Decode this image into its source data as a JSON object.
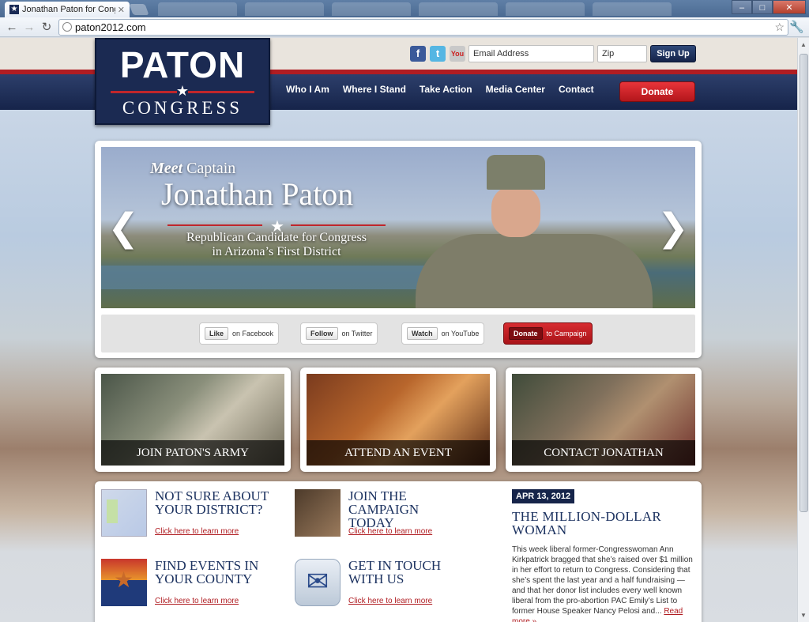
{
  "browser": {
    "tab_title": "Jonathan Paton for Congress",
    "url": "paton2012.com"
  },
  "header": {
    "logo_top": "PATON",
    "logo_bottom": "CONGRESS",
    "email_placeholder": "Email Address",
    "zip_placeholder": "Zip",
    "signup_label": "Sign Up",
    "nav": [
      "Who I Am",
      "Where I Stand",
      "Take Action",
      "Media Center",
      "Contact"
    ],
    "donate_label": "Donate",
    "social_icons": [
      "facebook-icon",
      "twitter-icon",
      "youtube-icon"
    ]
  },
  "hero": {
    "meet": "Meet",
    "captain": " Captain",
    "name": "Jonathan Paton",
    "subtitle_line1": "Republican Candidate for Congress",
    "subtitle_line2": "in Arizona’s First District",
    "buttons": [
      {
        "chip": "Like",
        "text": "on Facebook"
      },
      {
        "chip": "Follow",
        "text": "on Twitter"
      },
      {
        "chip": "Watch",
        "text": "on YouTube"
      },
      {
        "chip": "Donate",
        "text": "to Campaign"
      }
    ]
  },
  "cards": [
    {
      "caption": "JOIN PATON'S ARMY"
    },
    {
      "caption": "ATTEND AN EVENT"
    },
    {
      "caption": "CONTACT JONATHAN"
    }
  ],
  "features": [
    {
      "title": "NOT SURE ABOUT YOUR DISTRICT?",
      "link": "Click here to learn more"
    },
    {
      "title": "JOIN THE CAMPAIGN TODAY",
      "link": "Click here to learn more"
    },
    {
      "title": "FIND EVENTS IN YOUR COUNTY",
      "link": "Click here to learn more"
    },
    {
      "title": "GET IN TOUCH WITH US",
      "link": "Click here to learn more"
    }
  ],
  "news": {
    "date": "APR 13, 2012",
    "title": "THE MILLION-DOLLAR WOMAN",
    "body": "This week liberal former-Congresswoman Ann Kirkpatrick bragged that she’s raised over $1 million in her effort to return to Congress. Considering that she’s spent the last year and a half fundraising — and that her donor list includes every well known liberal from the pro-abortion PAC Emily’s List to former House Speaker Nancy Pelosi and... ",
    "read_more": "Read more »"
  },
  "colors": {
    "navy": "#16244a",
    "red": "#b01d22",
    "title_blue": "#1c3260"
  }
}
